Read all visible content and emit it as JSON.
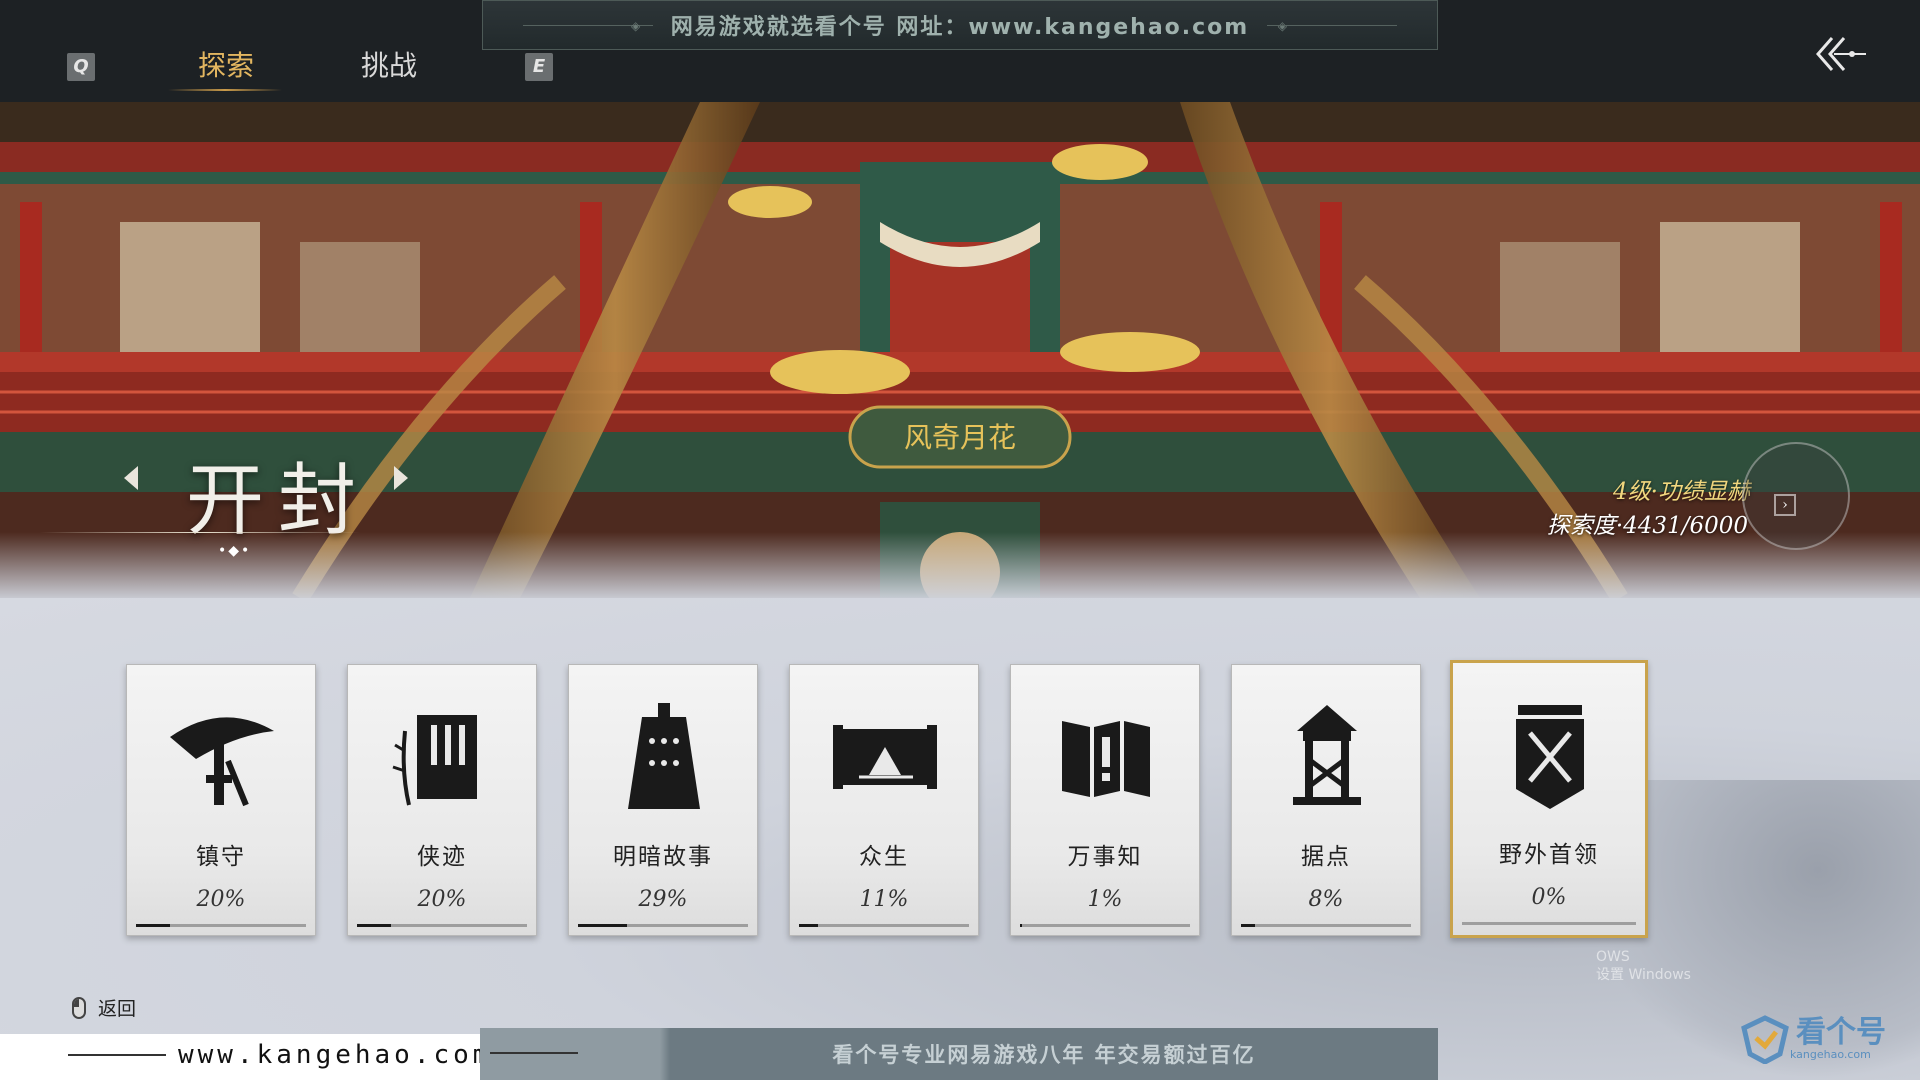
{
  "top_banner": {
    "text": "网易游戏就选看个号   网址：www.kangehao.com"
  },
  "tabs": {
    "key_left": "Q",
    "key_right": "E",
    "items": [
      {
        "label": "探索",
        "active": true
      },
      {
        "label": "挑战",
        "active": false
      }
    ]
  },
  "region": {
    "name": "开封",
    "level": "4级·功绩显赫",
    "exploration": "探索度·4431/6000",
    "plaque": "风奇月花"
  },
  "categories": [
    {
      "label": "镇守",
      "percent_text": "20%",
      "progress": 0.2,
      "icon": "bamboo-hat-sword-icon"
    },
    {
      "label": "侠迹",
      "percent_text": "20%",
      "progress": 0.2,
      "icon": "book-bamboo-icon"
    },
    {
      "label": "明暗故事",
      "percent_text": "29%",
      "progress": 0.29,
      "icon": "bell-icon"
    },
    {
      "label": "众生",
      "percent_text": "11%",
      "progress": 0.11,
      "icon": "scroll-painting-icon"
    },
    {
      "label": "万事知",
      "percent_text": "1%",
      "progress": 0.01,
      "icon": "folding-screen-icon"
    },
    {
      "label": "据点",
      "percent_text": "8%",
      "progress": 0.08,
      "icon": "watchtower-icon"
    },
    {
      "label": "野外首领",
      "percent_text": "0%",
      "progress": 0.0,
      "icon": "crossed-swords-banner-icon",
      "selected": true
    }
  ],
  "footer": {
    "back_label": "返回",
    "site": "www.kangehao.com",
    "ad_text": "看个号专业网易游戏八年  年交易额过百亿",
    "watermark_lines": [
      "OWS",
      "设置 Windows"
    ],
    "logo_name": "看个号",
    "logo_sub": "kangehao.com"
  },
  "colors": {
    "accent_gold": "#e3b660",
    "selected_border": "#c9a34c",
    "level_text": "#f1d77e"
  }
}
